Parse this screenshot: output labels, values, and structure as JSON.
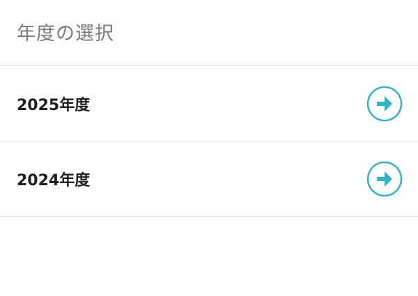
{
  "header": {
    "title": "年度の選択"
  },
  "years": [
    {
      "label": "2025年度",
      "icon": "arrow-right-circle-icon"
    },
    {
      "label": "2024年度",
      "icon": "arrow-right-circle-icon"
    }
  ],
  "colors": {
    "accent": "#2fb3c6",
    "title_text": "#7a7a7a",
    "row_text": "#1f1f1f",
    "divider": "#dcdcdc",
    "background": "#ffffff"
  }
}
